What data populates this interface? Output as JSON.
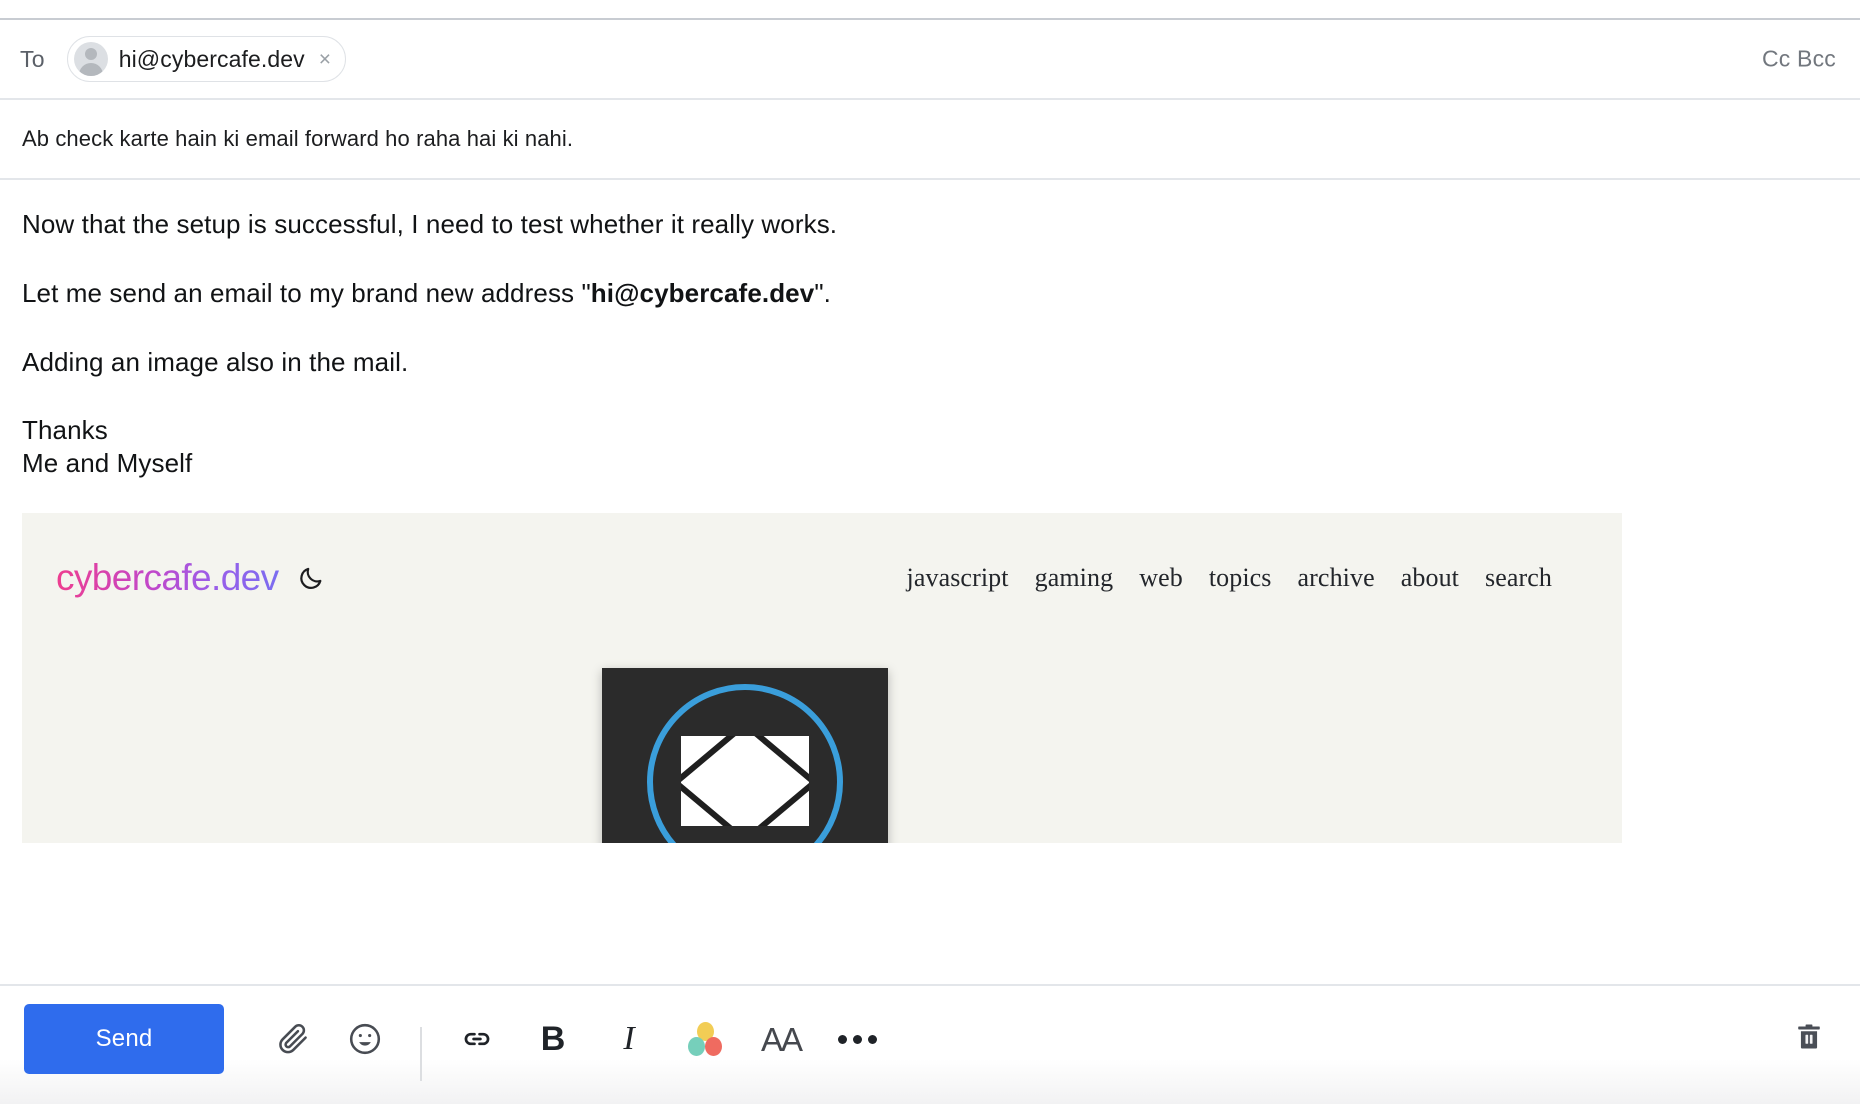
{
  "compose": {
    "to_label": "To",
    "recipient": {
      "email": "hi@cybercafe.dev",
      "remove_label": "×",
      "avatar_icon": "person-avatar-icon"
    },
    "cc_bcc_label": "Cc Bcc",
    "subject": "Ab check karte hain ki email forward ho raha hai ki nahi.",
    "clipped_top_text": "",
    "body": {
      "paragraph_1": "Now that the setup is successful, I need to test whether it really works.",
      "paragraph_2_prefix": "Let me send an email to my brand new address \"",
      "paragraph_2_bold": "hi@cybercafe.dev",
      "paragraph_2_suffix": "\".",
      "paragraph_3": "Adding an image also in the mail.",
      "signature_line_1": "Thanks",
      "signature_line_2": "Me and Myself"
    }
  },
  "embedded_image": {
    "background_color": "#f4f4ef",
    "site": {
      "logo_text": "cybercafe.dev",
      "logo_gradient_from": "#ee3d8f",
      "logo_gradient_to": "#7b6df0",
      "theme_toggle_icon": "moon-icon",
      "nav_items": [
        {
          "label": "javascript"
        },
        {
          "label": "gaming"
        },
        {
          "label": "web"
        },
        {
          "label": "topics"
        },
        {
          "label": "archive"
        },
        {
          "label": "about"
        },
        {
          "label": "search"
        }
      ]
    },
    "thumbnail": {
      "icon": "envelope-in-circle-icon",
      "background_color": "#2b2b2b",
      "ring_color": "#3a9edb",
      "envelope_color": "#ffffff"
    }
  },
  "toolbar": {
    "send_label": "Send",
    "accent_color": "#2f6ced",
    "items": [
      {
        "name": "attach-icon",
        "title": "Attach file"
      },
      {
        "name": "emoji-icon",
        "title": "Insert emoji"
      },
      {
        "name": "link-icon",
        "title": "Insert link"
      },
      {
        "name": "bold-icon",
        "title": "Bold",
        "glyph": "B"
      },
      {
        "name": "italic-icon",
        "title": "Italic",
        "glyph": "I"
      },
      {
        "name": "text-color-icon",
        "title": "Text color"
      },
      {
        "name": "font-size-icon",
        "title": "Font size",
        "glyph": "AA"
      },
      {
        "name": "more-options-icon",
        "title": "More options"
      }
    ],
    "colors": {
      "yellow": "#f2cd55",
      "teal": "#76cfbb",
      "red": "#ef6b60"
    },
    "discard": {
      "name": "trash-icon",
      "title": "Discard draft"
    }
  }
}
